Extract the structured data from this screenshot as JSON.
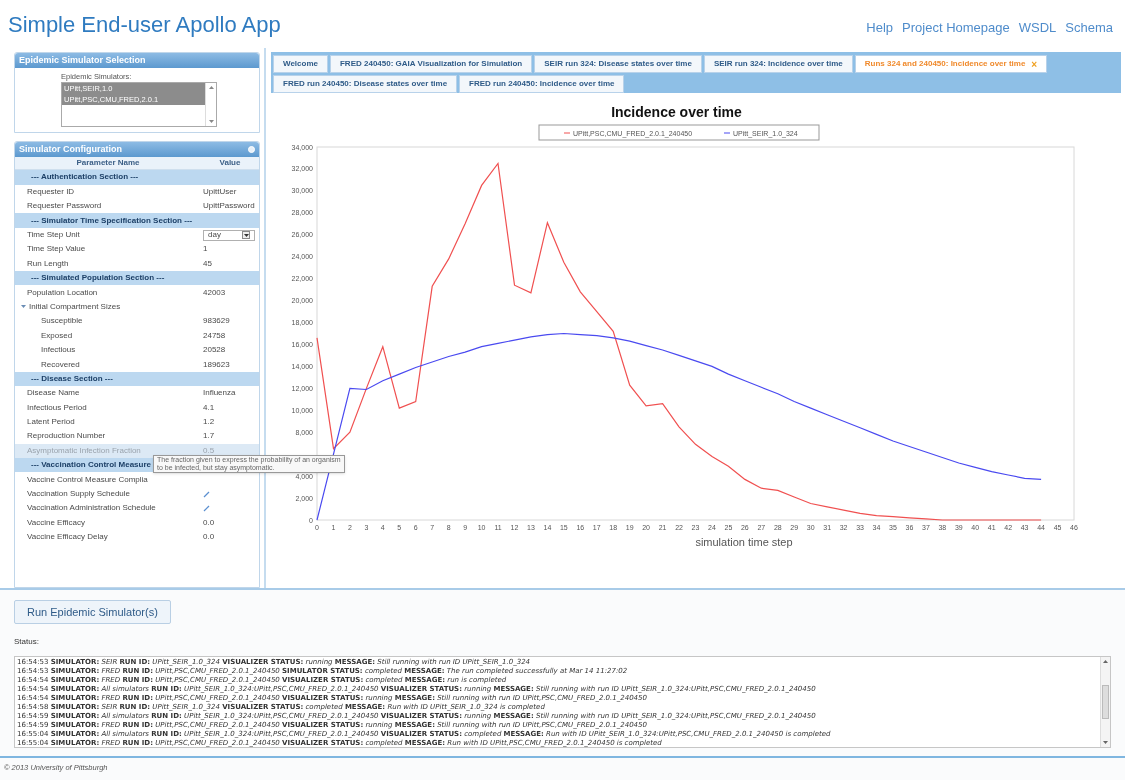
{
  "header": {
    "title": "Simple End-user Apollo App",
    "links": [
      "Help",
      "Project Homepage",
      "WSDL",
      "Schema"
    ]
  },
  "selection_panel": {
    "title": "Epidemic Simulator Selection",
    "label": "Epidemic Simulators:",
    "items": [
      {
        "label": "UPitt,SEIR,1.0",
        "selected": true
      },
      {
        "label": "UPitt,PSC,CMU,FRED,2.0.1",
        "selected": true
      }
    ]
  },
  "config_panel": {
    "title": "Simulator Configuration",
    "columns": [
      "Parameter Name",
      "Value"
    ],
    "rows": [
      {
        "kind": "section",
        "name": "--- Authentication Section ---",
        "highlighted": false
      },
      {
        "kind": "param",
        "name": "Requester ID",
        "value": "UpittUser",
        "highlighted": false
      },
      {
        "kind": "param",
        "name": "Requester Password",
        "value": "UpittPassword",
        "highlighted": false
      },
      {
        "kind": "section",
        "name": "--- Simulator Time Specification Section ---",
        "highlighted": false
      },
      {
        "kind": "dropdown",
        "name": "Time Step Unit",
        "value": "day",
        "highlighted": false
      },
      {
        "kind": "param",
        "name": "Time Step Value",
        "value": "1",
        "highlighted": false
      },
      {
        "kind": "param",
        "name": "Run Length",
        "value": "45",
        "highlighted": false
      },
      {
        "kind": "section",
        "name": "--- Simulated Population Section ---",
        "highlighted": false
      },
      {
        "kind": "param",
        "name": "Population Location",
        "value": "42003",
        "highlighted": false
      },
      {
        "kind": "group",
        "name": "Initial Compartment Sizes",
        "expanded": true,
        "highlighted": false
      },
      {
        "kind": "child",
        "name": "Susceptible",
        "value": "983629",
        "highlighted": false
      },
      {
        "kind": "child",
        "name": "Exposed",
        "value": "24758",
        "highlighted": false
      },
      {
        "kind": "child",
        "name": "Infectious",
        "value": "20528",
        "highlighted": false
      },
      {
        "kind": "child",
        "name": "Recovered",
        "value": "189623",
        "highlighted": false
      },
      {
        "kind": "section",
        "name": "--- Disease Section ---",
        "highlighted": false
      },
      {
        "kind": "param",
        "name": "Disease Name",
        "value": "Influenza",
        "highlighted": false
      },
      {
        "kind": "param",
        "name": "Infectious Period",
        "value": "4.1",
        "highlighted": false
      },
      {
        "kind": "param",
        "name": "Latent Period",
        "value": "1.2",
        "highlighted": false
      },
      {
        "kind": "param",
        "name": "Reproduction Number",
        "value": "1.7",
        "highlighted": false
      },
      {
        "kind": "param",
        "name": "Asymptomatic Infection Fraction",
        "value": "0.5",
        "highlighted": true
      },
      {
        "kind": "section",
        "name": "--- Vaccination Control Measure",
        "highlighted": false
      },
      {
        "kind": "param",
        "name": "Vaccine Control Measure Complia",
        "highlighted": false
      },
      {
        "kind": "edit",
        "name": "Vaccination Supply Schedule",
        "highlighted": false
      },
      {
        "kind": "edit",
        "name": "Vaccination Administration Schedule",
        "highlighted": false
      },
      {
        "kind": "param",
        "name": "Vaccine Efficacy",
        "value": "0.0",
        "highlighted": false
      },
      {
        "kind": "param",
        "name": "Vaccine Efficacy Delay",
        "value": "0.0",
        "highlighted": false
      }
    ],
    "tooltip": "The fraction given to express the probability of an organism to be infected, but stay asymptomatic."
  },
  "tabs": [
    {
      "label": "Welcome",
      "selected": false
    },
    {
      "label": "FRED 240450: GAIA Visualization for Simulation",
      "selected": false
    },
    {
      "label": "SEIR run 324: Disease states over time",
      "selected": false
    },
    {
      "label": "SEIR run 324: Incidence over time",
      "selected": false
    },
    {
      "label": "Runs 324 and 240450: Incidence over time",
      "selected": true,
      "close": "×"
    },
    {
      "label": "FRED run 240450: Disease states over time",
      "selected": false
    },
    {
      "label": "FRED run 240450: Incidence over time",
      "selected": false
    }
  ],
  "chart_data": {
    "type": "line",
    "title": "Incidence over time",
    "xlabel": "simulation time step",
    "legend": "top",
    "x": [
      0,
      1,
      2,
      3,
      4,
      5,
      6,
      7,
      8,
      9,
      10,
      11,
      12,
      13,
      14,
      15,
      16,
      17,
      18,
      19,
      20,
      21,
      22,
      23,
      24,
      25,
      26,
      27,
      28,
      29,
      30,
      31,
      32,
      33,
      34,
      35,
      36,
      37,
      38,
      39,
      40,
      41,
      42,
      43,
      44
    ],
    "series": [
      {
        "name": "UPitt,PSC,CMU_FRED_2.0.1_240450",
        "color": "#f05050",
        "values": [
          16600,
          6500,
          8000,
          12000,
          15800,
          10200,
          10800,
          21300,
          23800,
          27000,
          30500,
          32500,
          21400,
          20700,
          27100,
          23500,
          20800,
          19000,
          17200,
          12300,
          10400,
          10600,
          8500,
          6900,
          5800,
          4900,
          3700,
          2900,
          2700,
          2100,
          1500,
          1200,
          900,
          600,
          400,
          300,
          200,
          100,
          0,
          0,
          0,
          0,
          0,
          0,
          0
        ]
      },
      {
        "name": "UPitt_SEIR_1.0_324",
        "color": "#4a4af0",
        "values": [
          0,
          6000,
          12000,
          11900,
          12700,
          13300,
          13900,
          14400,
          14900,
          15300,
          15800,
          16100,
          16400,
          16700,
          16900,
          17000,
          16900,
          16800,
          16600,
          16300,
          15900,
          15500,
          15000,
          14500,
          14000,
          13300,
          12700,
          12100,
          11500,
          10800,
          10200,
          9600,
          9000,
          8400,
          7800,
          7200,
          6700,
          6200,
          5700,
          5200,
          4800,
          4400,
          4100,
          3800,
          3700
        ]
      }
    ],
    "xlim": [
      0,
      46
    ],
    "ylim": [
      0,
      34000
    ],
    "xticks": [
      0,
      1,
      2,
      3,
      4,
      5,
      6,
      7,
      8,
      9,
      10,
      11,
      12,
      13,
      14,
      15,
      16,
      17,
      18,
      19,
      20,
      21,
      22,
      23,
      24,
      25,
      26,
      27,
      28,
      29,
      30,
      31,
      32,
      33,
      34,
      35,
      36,
      37,
      38,
      39,
      40,
      41,
      42,
      43,
      44,
      45,
      46
    ],
    "yticks": [
      {
        "value": 0,
        "label": "0"
      },
      {
        "value": 2000,
        "label": "2,000"
      },
      {
        "value": 4000,
        "label": "4,000"
      },
      {
        "value": 8000,
        "label": "8,000"
      },
      {
        "value": 10000,
        "label": "10,000"
      },
      {
        "value": 12000,
        "label": "12,000"
      },
      {
        "value": 14000,
        "label": "14,000"
      },
      {
        "value": 16000,
        "label": "16,000"
      },
      {
        "value": 18000,
        "label": "18,000"
      },
      {
        "value": 20000,
        "label": "20,000"
      },
      {
        "value": 22000,
        "label": "22,000"
      },
      {
        "value": 24000,
        "label": "24,000"
      },
      {
        "value": 26000,
        "label": "26,000"
      },
      {
        "value": 28000,
        "label": "28,000"
      },
      {
        "value": 30000,
        "label": "30,000"
      },
      {
        "value": 32000,
        "label": "32,000"
      },
      {
        "value": 34000,
        "label": "34,000"
      }
    ]
  },
  "run_button": "Run Epidemic Simulator(s)",
  "status_label": "Status:",
  "log": [
    "16:54:53 **SIMULATOR:** *SEIR* **RUN ID:** *UPitt_SEIR_1.0_324* **VISUALIZER STATUS:** *running* **MESSAGE:** *Still running with run ID UPitt_SEIR_1.0_324*",
    "16:54:53 **SIMULATOR:** *FRED* **RUN ID:** *UPitt,PSC,CMU_FRED_2.0.1_240450* **SIMULATOR STATUS:** *completed* **MESSAGE:** *The run completed successfully at Mar 14 11:27:02*",
    "16:54:54 **SIMULATOR:** *FRED* **RUN ID:** *UPitt,PSC,CMU_FRED_2.0.1_240450* **VISUALIZER STATUS:** *completed* **MESSAGE:** *run is completed*",
    "16:54:54 **SIMULATOR:** *All simulators* **RUN ID:** *UPitt_SEIR_1.0_324:UPitt,PSC,CMU_FRED_2.0.1_240450* **VISUALIZER STATUS:** *running* **MESSAGE:** *Still running with run ID UPitt_SEIR_1.0_324:UPitt,PSC,CMU_FRED_2.0.1_240450*",
    "16:54:54 **SIMULATOR:** *FRED* **RUN ID:** *UPitt,PSC,CMU_FRED_2.0.1_240450* **VISUALIZER STATUS:** *running* **MESSAGE:** *Still running with run ID UPitt,PSC,CMU_FRED_2.0.1_240450*",
    "16:54:58 **SIMULATOR:** *SEIR* **RUN ID:** *UPitt_SEIR_1.0_324* **VISUALIZER STATUS:** *completed* **MESSAGE:** *Run with ID UPitt_SEIR_1.0_324 is completed*",
    "16:54:59 **SIMULATOR:** *All simulators* **RUN ID:** *UPitt_SEIR_1.0_324:UPitt,PSC,CMU_FRED_2.0.1_240450* **VISUALIZER STATUS:** *running* **MESSAGE:** *Still running with run ID UPitt_SEIR_1.0_324:UPitt,PSC,CMU_FRED_2.0.1_240450*",
    "16:54:59 **SIMULATOR:** *FRED* **RUN ID:** *UPitt,PSC,CMU_FRED_2.0.1_240450* **VISUALIZER STATUS:** *running* **MESSAGE:** *Still running with run ID UPitt,PSC,CMU_FRED_2.0.1_240450*",
    "16:55:04 **SIMULATOR:** *All simulators* **RUN ID:** *UPitt_SEIR_1.0_324:UPitt,PSC,CMU_FRED_2.0.1_240450* **VISUALIZER STATUS:** *completed* **MESSAGE:** *Run with ID UPitt_SEIR_1.0_324:UPitt,PSC,CMU_FRED_2.0.1_240450 is completed*",
    "16:55:04 **SIMULATOR:** *FRED* **RUN ID:** *UPitt,PSC,CMU_FRED_2.0.1_240450* **VISUALIZER STATUS:** *completed* **MESSAGE:** *Run with ID UPitt,PSC,CMU_FRED_2.0.1_240450 is completed*"
  ],
  "footer": "© 2013 University of Pittsburgh"
}
